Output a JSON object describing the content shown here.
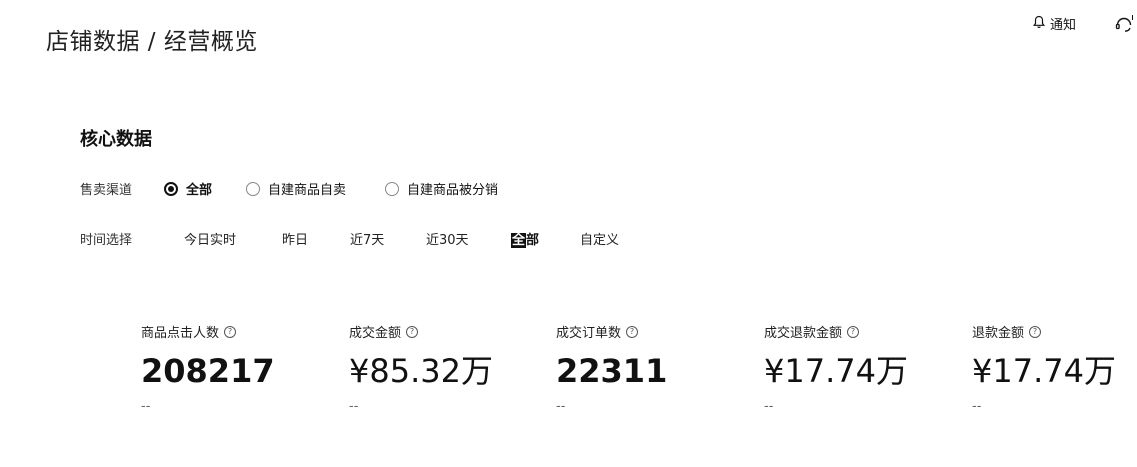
{
  "header": {
    "title": "店铺数据 / 经营概览",
    "notify_label": "通知"
  },
  "core": {
    "title": "核心数据",
    "channel": {
      "label": "售卖渠道",
      "options": [
        {
          "label": "全部",
          "checked": true
        },
        {
          "label": "自建商品自卖",
          "checked": false
        },
        {
          "label": "自建商品被分销",
          "checked": false
        }
      ]
    },
    "time": {
      "label": "时间选择",
      "options": [
        "今日实时",
        "昨日",
        "近7天",
        "近30天",
        "全部",
        "自定义"
      ],
      "active": "全部"
    },
    "metrics": [
      {
        "label": "商品点击人数",
        "value": "208217",
        "sub": "--"
      },
      {
        "label": "成交金额",
        "value": "¥85.32万",
        "sub": "--"
      },
      {
        "label": "成交订单数",
        "value": "22311",
        "sub": "--"
      },
      {
        "label": "成交退款金额",
        "value": "¥17.74万",
        "sub": "--"
      },
      {
        "label": "退款金额",
        "value": "¥17.74万",
        "sub": "--"
      }
    ]
  }
}
